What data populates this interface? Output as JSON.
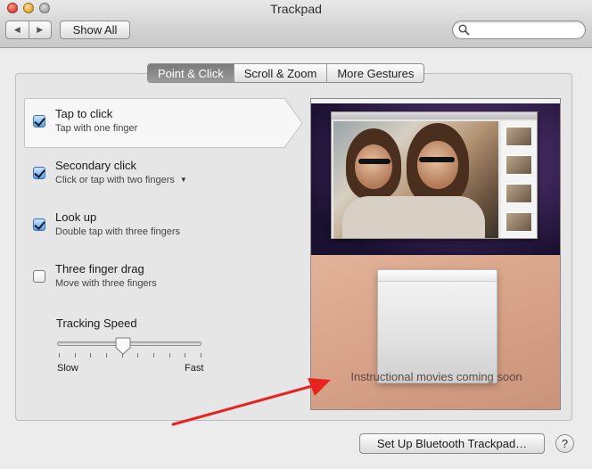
{
  "window": {
    "title": "Trackpad",
    "show_all_label": "Show All",
    "back_icon": "back-arrow-icon",
    "forward_icon": "forward-arrow-icon",
    "search": {
      "value": "",
      "placeholder": ""
    }
  },
  "tabs": [
    {
      "label": "Point & Click",
      "selected": true
    },
    {
      "label": "Scroll & Zoom",
      "selected": false
    },
    {
      "label": "More Gestures",
      "selected": false
    }
  ],
  "options": [
    {
      "title": "Tap to click",
      "subtitle": "Tap with one finger",
      "checked": true,
      "selected": true
    },
    {
      "title": "Secondary click",
      "subtitle": "Click or tap with two fingers",
      "checked": true,
      "has_dropdown": true
    },
    {
      "title": "Look up",
      "subtitle": "Double tap with three fingers",
      "checked": true
    },
    {
      "title": "Three finger drag",
      "subtitle": "Move with three fingers",
      "checked": false
    }
  ],
  "tracking_speed": {
    "label": "Tracking Speed",
    "min_label": "Slow",
    "max_label": "Fast",
    "value_fraction": 0.45,
    "tick_count": 10
  },
  "preview": {
    "message": "Instructional movies coming soon"
  },
  "footer": {
    "bluetooth_button": "Set Up Bluetooth Trackpad…",
    "help_label": "?"
  },
  "colors": {
    "annotation_arrow": "#e8231f",
    "checkbox_checked": "#5aa0e8",
    "tab_selected": "#8a8a8a"
  }
}
